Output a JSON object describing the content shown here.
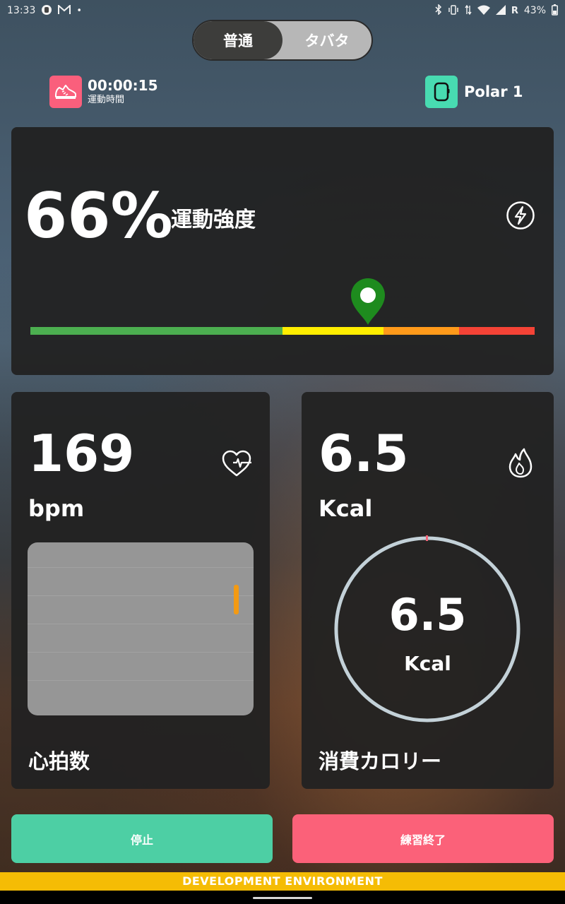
{
  "status_bar": {
    "time": "13:33",
    "carrier_indicator": "R",
    "battery": "43%",
    "icons": [
      "notification-icon",
      "mail-icon",
      "dot-icon",
      "bluetooth-icon",
      "vibrate-icon",
      "data-icon",
      "wifi-icon",
      "signal-icon",
      "battery-icon"
    ]
  },
  "mode_toggle": {
    "options": [
      {
        "label": "普通",
        "active": true
      },
      {
        "label": "タバタ",
        "active": false
      }
    ]
  },
  "timer": {
    "value": "00:00:15",
    "label": "運動時間",
    "icon": "shoe-icon"
  },
  "device": {
    "name": "Polar 1",
    "icon": "watch-icon"
  },
  "intensity": {
    "value": "66%",
    "label": "運動強度",
    "level": 0.67,
    "icon": "lightning-icon",
    "zones": [
      {
        "color": "#4caf50",
        "fraction": 0.5
      },
      {
        "color": "#ffee00",
        "fraction": 0.2
      },
      {
        "color": "#ff9a1a",
        "fraction": 0.15
      },
      {
        "color": "#f44336",
        "fraction": 0.15
      }
    ],
    "pin_color": "#1e8b1e"
  },
  "heart_rate": {
    "value": "169",
    "unit": "bpm",
    "title": "心拍数",
    "icon": "heart-pulse-icon",
    "marker_color": "#f39a13"
  },
  "calories": {
    "value": "6.5",
    "unit": "Kcal",
    "ring_value": "6.5",
    "ring_unit": "Kcal",
    "title": "消費カロリー",
    "icon": "flame-icon",
    "ring_color": "#c3d1d8"
  },
  "buttons": {
    "stop": "停止",
    "end": "練習終了"
  },
  "banner": "DEVELOPMENT ENVIRONMENT",
  "colors": {
    "accent_green": "#4dcfa4",
    "accent_pink": "#fb6179",
    "banner": "#f5bc05"
  }
}
